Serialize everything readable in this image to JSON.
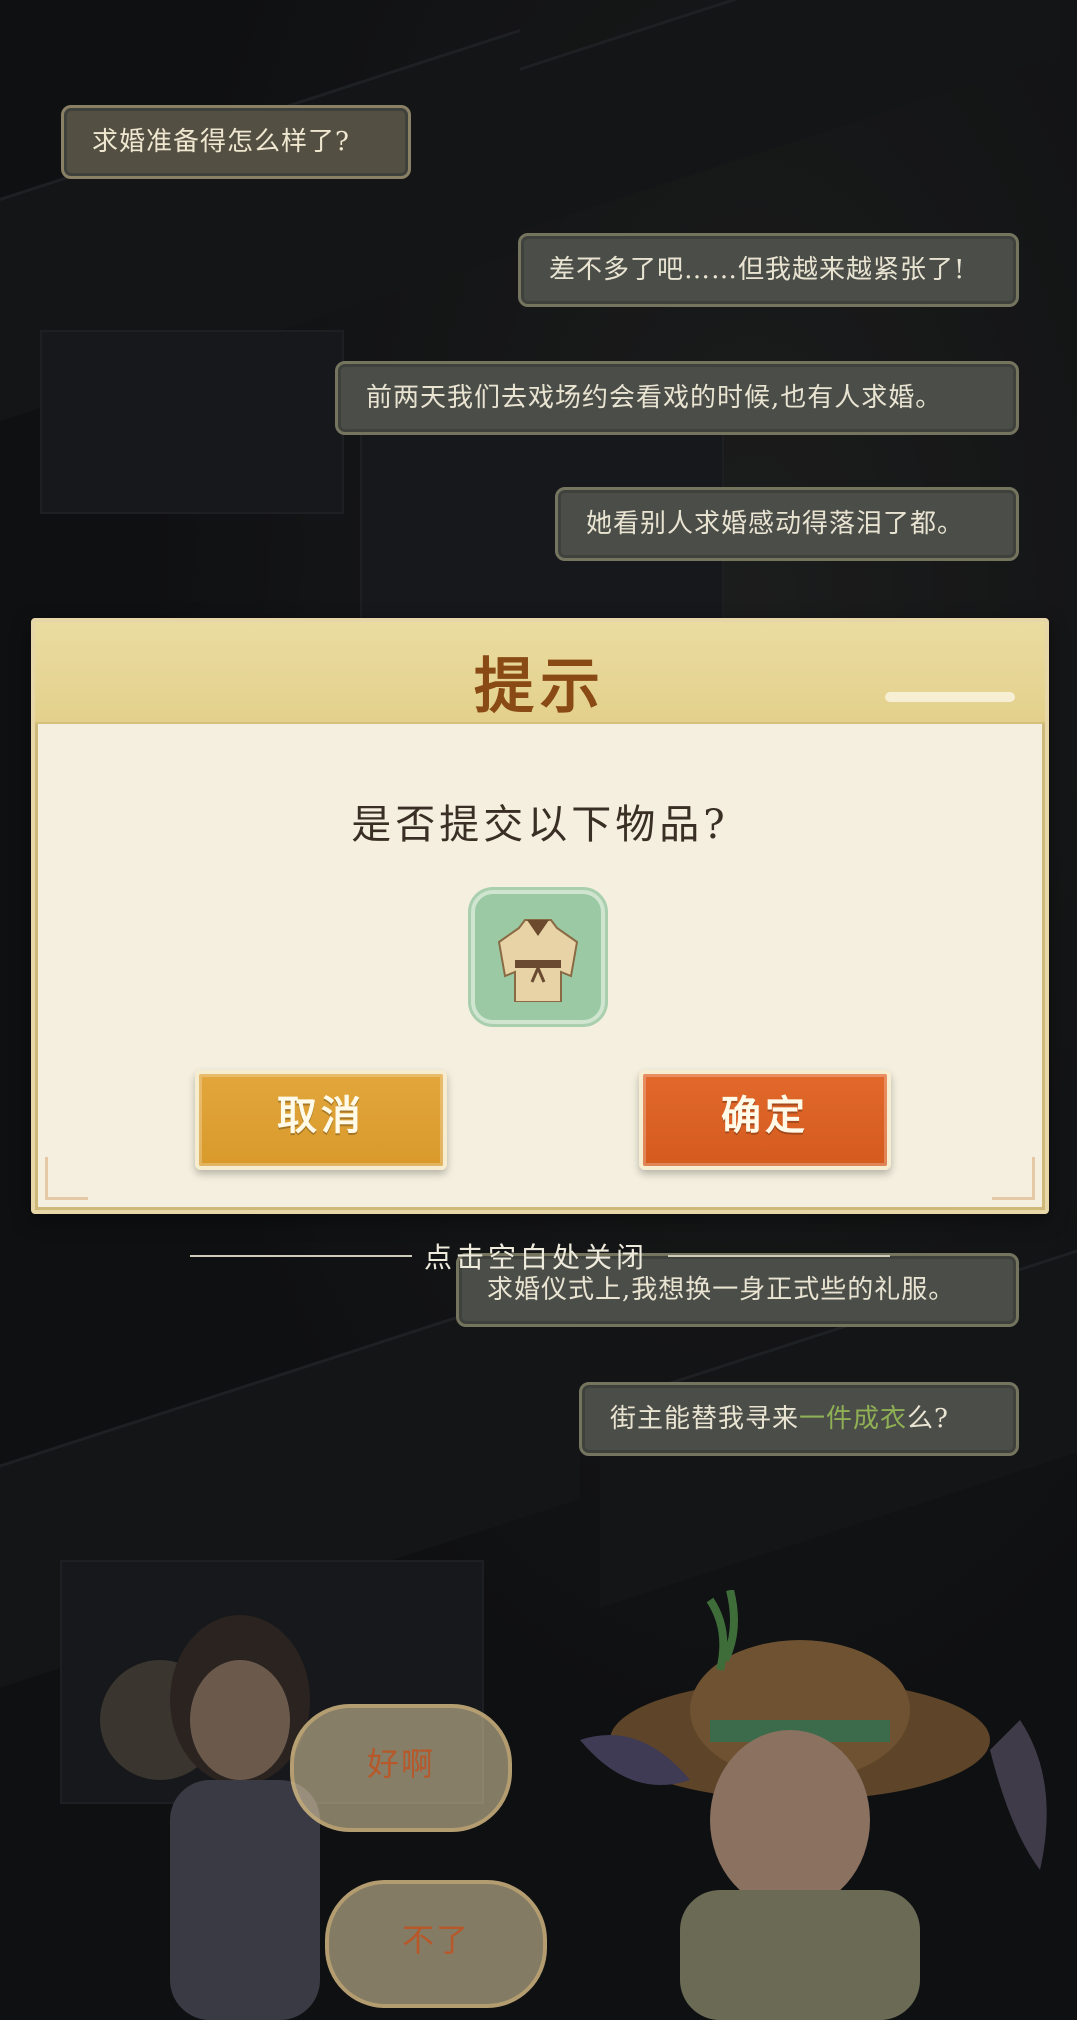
{
  "chat": [
    {
      "text": "求婚准备得怎么样了?",
      "side": "left"
    },
    {
      "text": "差不多了吧……但我越来越紧张了!",
      "side": "right"
    },
    {
      "text": "前两天我们去戏场约会看戏的时候,也有人求婚。",
      "side": "right"
    },
    {
      "text": "她看别人求婚感动得落泪了都。",
      "side": "right"
    },
    {
      "text": "求婚仪式上,我想换一身正式些的礼服。",
      "side": "right"
    },
    {
      "text_prefix": "街主能替我寻来",
      "text_highlight": "一件成衣",
      "text_suffix": "么?",
      "side": "right"
    }
  ],
  "dialog": {
    "title": "提示",
    "question": "是否提交以下物品?",
    "item_icon": "robe-icon",
    "cancel_label": "取消",
    "confirm_label": "确定"
  },
  "close_hint": "点击空白处关闭",
  "choices": [
    "好啊",
    "不了"
  ],
  "colors": {
    "title": "#8a4a15",
    "cancel": "#d99a2b",
    "confirm": "#d45b1d",
    "highlight": "#8fb054"
  }
}
